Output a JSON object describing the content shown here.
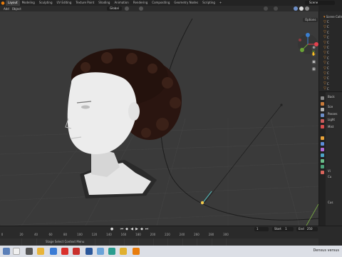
{
  "menu": {
    "tabs": [
      "Layout",
      "Modeling",
      "Sculpting",
      "UV Editing",
      "Texture Paint",
      "Shading",
      "Animation",
      "Rendering",
      "Compositing",
      "Geometry Nodes",
      "Scripting",
      "+"
    ],
    "active_tab": "Layout",
    "scene": "Scene"
  },
  "header": {
    "add": "Add",
    "object": "Object",
    "orientation": "Global",
    "options": "Options"
  },
  "outliner": {
    "title": "Scene Collection",
    "rows": [
      "Scene Collection",
      "C",
      "C",
      "C",
      "C",
      "C",
      "C",
      "C",
      "C",
      "C",
      "C",
      "C",
      "C",
      "C",
      "C"
    ]
  },
  "properties": {
    "rows": [
      "Back",
      "Sce",
      "Passes",
      "Light",
      "Mist",
      "Vi",
      "Cu",
      "Cus"
    ]
  },
  "timeline": {
    "ticks": [
      "20",
      "40",
      "60",
      "80",
      "100",
      "120",
      "140",
      "160",
      "180",
      "200",
      "220",
      "240",
      "260",
      "280",
      "300"
    ],
    "first_tick": "0",
    "current_frame": "1",
    "start_label": "Start",
    "start_value": "1",
    "end_label": "End",
    "end_value": "250"
  },
  "status": {
    "hint": "Stage Select Context Menu"
  },
  "taskbar": {
    "right_text": "Densus versus"
  },
  "colors": {
    "accent_orange": "#e87d0d",
    "viewport_bg": "#3a3a3a",
    "axis_x": "#e2414d",
    "axis_y": "#6aa336",
    "axis_z": "#3b7fd0"
  }
}
